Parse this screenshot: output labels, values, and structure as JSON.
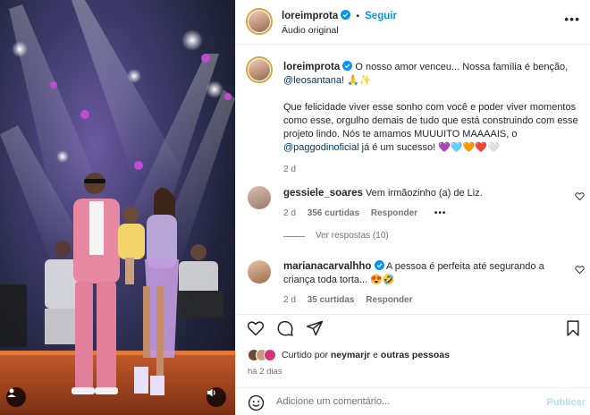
{
  "header": {
    "username": "loreimprota",
    "separator": "•",
    "follow_label": "Seguir",
    "audio_label": "Áudio original",
    "more_label": "•••"
  },
  "caption": {
    "username": "loreimprota",
    "line1_text": "O nosso amor venceu... Nossa família é benção,",
    "mention1": "@leosantana",
    "line1_suffix": "! 🙏✨",
    "para2_text": "Que felicidade viver esse sonho com você e poder viver momentos como esse, orgulho demais de tudo que está construindo com esse projeto lindo. Nós te amamos MUUUITO MAAAAIS, o",
    "mention2": "@paggodinoficial",
    "para2_suffix": " já é um sucesso! 💜🩵🧡❤️🤍",
    "time": "2 d"
  },
  "comments": [
    {
      "username": "gessiele_soares",
      "text": "Vem irmãozinho (a) de Liz.",
      "time": "2 d",
      "likes": "356 curtidas",
      "reply_label": "Responder",
      "more_label": "•••",
      "view_replies": "Ver respostas (10)"
    },
    {
      "username": "marianacarvalhho",
      "text": "A pessoa é perfeita até segurando a criança toda torta... 😍🤣",
      "time": "2 d",
      "likes": "35 curtidas",
      "reply_label": "Responder"
    }
  ],
  "likes": {
    "prefix": "Curtido por ",
    "user": "neymarjr",
    "middle": " e ",
    "others": "outras pessoas"
  },
  "posted_ago": "há 2 dias",
  "comment_box": {
    "placeholder": "Adicione um comentário...",
    "publish_label": "Publicar"
  },
  "icons": {
    "like": "heart-icon",
    "comment": "comment-icon",
    "share": "send-icon",
    "save": "bookmark-icon",
    "emoji": "smiley-icon",
    "verified": "verified-badge-icon",
    "user_tags": "user-icon",
    "audio": "speaker-icon"
  },
  "colors": {
    "accent": "#0095f6",
    "mention": "#00376b",
    "muted": "#737373"
  }
}
